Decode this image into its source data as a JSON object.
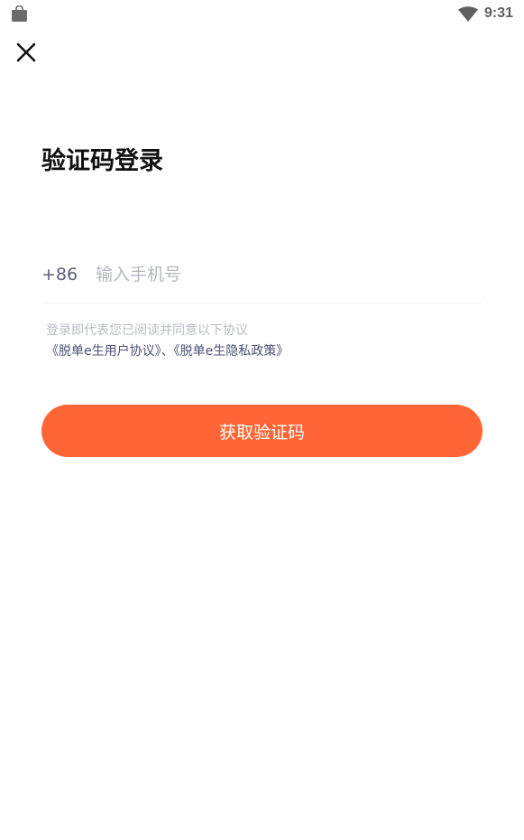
{
  "status_bar": {
    "time": "9:31",
    "left_icon": "shopping-bag-icon",
    "right_icon": "wifi-icon"
  },
  "header": {
    "close_icon": "close-icon"
  },
  "page": {
    "title": "验证码登录"
  },
  "phone": {
    "country_code": "+86",
    "placeholder": "输入手机号",
    "value": ""
  },
  "agreement": {
    "hint": "登录即代表您已阅读并同意以下协议",
    "user_agreement": "《脱单e生用户协议》",
    "separator": "、",
    "privacy_policy": "《脱单e生隐私政策》"
  },
  "actions": {
    "get_code_label": "获取验证码"
  },
  "colors": {
    "accent": "#ff6535",
    "link": "#4a5273",
    "hint": "#b9bcc5",
    "placeholder": "#b4b7c0",
    "title": "#111111"
  }
}
